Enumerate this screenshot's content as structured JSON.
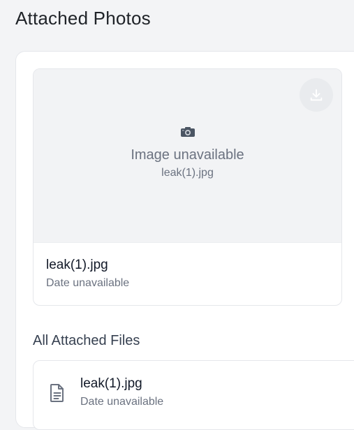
{
  "page": {
    "title": "Attached Photos"
  },
  "photo_card": {
    "placeholder_text": "Image unavailable",
    "preview_filename": "leak(1).jpg",
    "filename": "leak(1).jpg",
    "date": "Date unavailable",
    "icons": {
      "camera": "camera-icon",
      "download": "download-icon"
    }
  },
  "files_section": {
    "heading": "All Attached Files",
    "files": [
      {
        "name": "leak(1).jpg",
        "date": "Date unavailable",
        "icon": "file-text-icon"
      }
    ]
  },
  "colors": {
    "background": "#f3f4f6",
    "card": "#ffffff",
    "muted_text": "#6b7280",
    "border": "#e5e7eb"
  }
}
